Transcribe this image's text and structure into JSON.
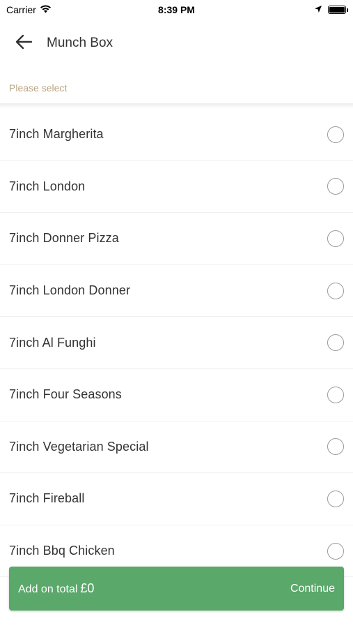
{
  "status_bar": {
    "carrier": "Carrier",
    "time": "8:39 PM",
    "icons": [
      "wifi-icon",
      "location-arrow-icon",
      "battery-icon"
    ]
  },
  "header": {
    "back_icon": "arrow-left-icon",
    "title": "Munch Box"
  },
  "prompt": "Please select",
  "options": [
    {
      "label": "7inch Margherita"
    },
    {
      "label": "7inch London"
    },
    {
      "label": "7inch Donner Pizza"
    },
    {
      "label": "7inch London Donner"
    },
    {
      "label": "7inch Al Funghi"
    },
    {
      "label": "7inch Four Seasons"
    },
    {
      "label": "7inch Vegetarian Special"
    },
    {
      "label": "7inch Fireball"
    },
    {
      "label": "7inch Bbq Chicken"
    }
  ],
  "footer": {
    "total_label": "Add on total",
    "total_amount": "£0",
    "continue_label": "Continue"
  },
  "colors": {
    "accent_green": "#5aa86a",
    "prompt_tan": "#b9a482",
    "text_dark": "#333333"
  }
}
